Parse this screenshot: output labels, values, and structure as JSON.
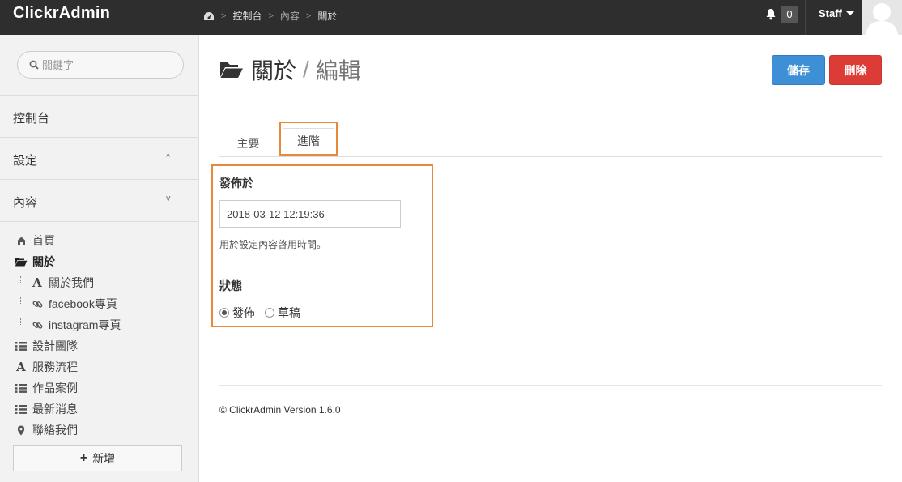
{
  "app": {
    "brand": "ClickrAdmin"
  },
  "breadcrumb": {
    "items": [
      "控制台",
      "內容",
      "關於"
    ],
    "separator": ">"
  },
  "topbar": {
    "notification_count": "0",
    "user_label": "Staff"
  },
  "sidebar": {
    "search_placeholder": "關鍵字",
    "menu": [
      {
        "label": "控制台",
        "chevron": ""
      },
      {
        "label": "設定",
        "chevron": "^"
      },
      {
        "label": "內容",
        "chevron": "v"
      }
    ],
    "tree": [
      {
        "label": "首頁",
        "icon": "home-icon"
      },
      {
        "label": "關於",
        "icon": "folder-open-icon",
        "active": true
      },
      {
        "label": "關於我們",
        "icon": "text-icon"
      },
      {
        "label": "facebook專頁",
        "icon": "link-icon"
      },
      {
        "label": "instagram專頁",
        "icon": "link-icon"
      },
      {
        "label": "設計團隊",
        "icon": "list-icon"
      },
      {
        "label": "服務流程",
        "icon": "text-icon"
      },
      {
        "label": "作品案例",
        "icon": "list-icon"
      },
      {
        "label": "最新消息",
        "icon": "list-icon"
      },
      {
        "label": "聯絡我們",
        "icon": "map-marker-icon"
      }
    ],
    "add_label": "新增"
  },
  "main": {
    "title": "關於",
    "title_separator": "/",
    "subtitle": "編輯",
    "save_label": "儲存",
    "delete_label": "刪除",
    "tabs": [
      {
        "label": "主要"
      },
      {
        "label": "進階",
        "active": true
      }
    ],
    "publish_label": "發佈於",
    "publish_value": "2018-03-12 12:19:36",
    "publish_help": "用於設定內容啓用時間。",
    "status_label": "狀態",
    "status_options": [
      {
        "label": "發佈",
        "checked": true
      },
      {
        "label": "草稿",
        "checked": false
      }
    ]
  },
  "footer": {
    "text": "© ClickrAdmin Version 1.6.0"
  },
  "colors": {
    "topbar": "#2e2e2e",
    "save": "#3d8fd6",
    "delete": "#dd3b36",
    "highlight": "#e8893a"
  }
}
